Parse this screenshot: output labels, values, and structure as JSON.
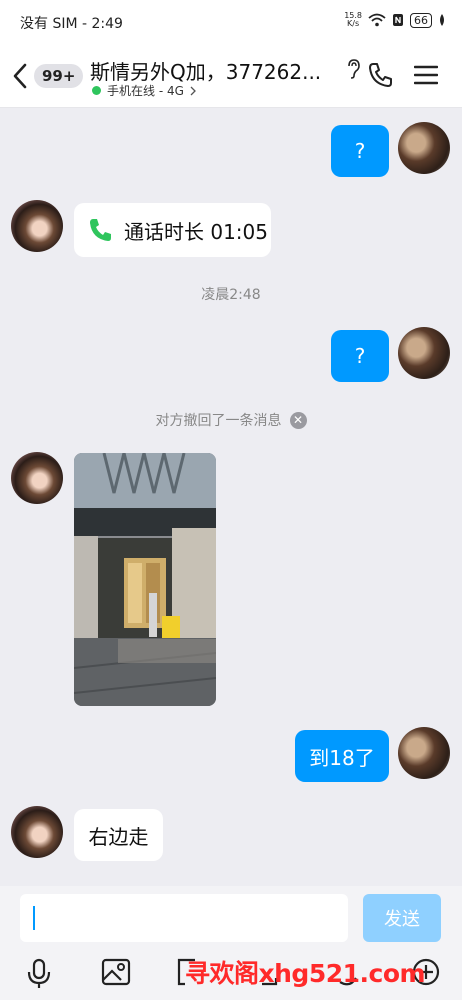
{
  "status_bar": {
    "carrier_time": "没有 SIM - 2:49",
    "net_speed_value": "15.8",
    "net_speed_unit": "K/s",
    "battery": "66"
  },
  "header": {
    "unread_badge": "99+",
    "title": "斯情另外Q加，377262...",
    "online_status": "手机在线 - 4G",
    "icons": [
      "back-arrow-icon",
      "ear-icon",
      "phone-icon",
      "menu-icon"
    ]
  },
  "messages": [
    {
      "from": "me",
      "type": "text",
      "text": "?"
    },
    {
      "from": "other",
      "type": "call",
      "text": "通话时长 01:05"
    },
    {
      "type": "time",
      "text": "凌晨2:48"
    },
    {
      "from": "me",
      "type": "text",
      "text": "?"
    },
    {
      "type": "recall",
      "text": "对方撤回了一条消息"
    },
    {
      "from": "other",
      "type": "image"
    },
    {
      "from": "me",
      "type": "text",
      "text": "到18了"
    },
    {
      "from": "other",
      "type": "text",
      "text": "右边走"
    }
  ],
  "input": {
    "value": "",
    "send_label": "发送"
  },
  "watermark": "寻欢阁xhg521.com",
  "toolbar_icons": [
    "microphone-icon",
    "image-icon",
    "camera-icon",
    "file-icon",
    "emoji-icon",
    "plus-icon"
  ],
  "colors": {
    "accent": "#0099ff",
    "send_disabled": "#8fd0ff",
    "online": "#2fc55d",
    "call_icon": "#2fc55d"
  }
}
